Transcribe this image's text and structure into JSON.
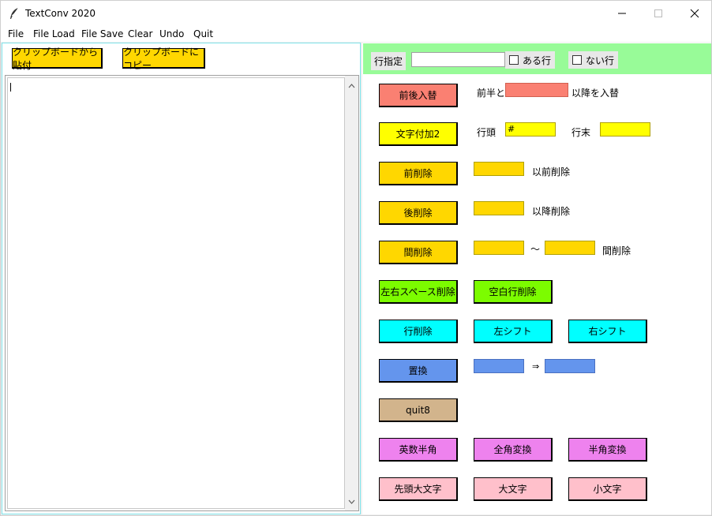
{
  "window": {
    "title": "TextConv 2020",
    "controls": {
      "minimize": "—",
      "maximize": "☐",
      "close": "✕"
    }
  },
  "menu": [
    "File",
    "File Load",
    "File Save",
    "Clear",
    "Undo",
    "Quit"
  ],
  "clipboard": {
    "paste_label": "クリップボードから貼付",
    "copy_label": "クリップボードにコピー"
  },
  "editor": {
    "value": ""
  },
  "filter": {
    "line_spec_label": "行指定",
    "line_spec_value": "",
    "has_line_label": "ある行",
    "no_line_label": "ない行"
  },
  "actions": {
    "swap": {
      "button": "前後入替",
      "prefix": "前半と",
      "value": "",
      "suffix": "以降を入替"
    },
    "append": {
      "button": "文字付加2",
      "head_label": "行頭",
      "head_value": "#",
      "tail_label": "行末",
      "tail_value": ""
    },
    "delete_before": {
      "button": "前削除",
      "value": "",
      "suffix": "以前削除"
    },
    "delete_after": {
      "button": "後削除",
      "value": "",
      "suffix": "以降削除"
    },
    "delete_between": {
      "button": "間削除",
      "from": "",
      "tilde": "〜",
      "to": "",
      "suffix": "間削除"
    },
    "trim_spaces": {
      "button": "左右スペース削除"
    },
    "remove_blank": {
      "button": "空白行削除"
    },
    "delete_line": {
      "button": "行削除"
    },
    "shift_left": {
      "button": "左シフト"
    },
    "shift_right": {
      "button": "右シフト"
    },
    "replace": {
      "button": "置換",
      "from": "",
      "arrow": "⇒",
      "to": ""
    },
    "quit8": {
      "button": "quit8"
    },
    "to_halfwidth_alnum": {
      "button": "英数半角"
    },
    "to_fullwidth": {
      "button": "全角変換"
    },
    "to_halfwidth": {
      "button": "半角変換"
    },
    "capitalize": {
      "button": "先頭大文字"
    },
    "uppercase": {
      "button": "大文字"
    },
    "lowercase": {
      "button": "小文字"
    }
  },
  "colors": {
    "salmon": "#fa8072",
    "yellow": "#ffff00",
    "gold": "#ffd700",
    "lawngreen": "#7cfc00",
    "cyan": "#00ffff",
    "cornflowerblue": "#6495ed",
    "tan": "#d2b48c",
    "violet": "#ee82ee",
    "pink": "#ffc0cb",
    "palegreen": "#98fb98"
  }
}
